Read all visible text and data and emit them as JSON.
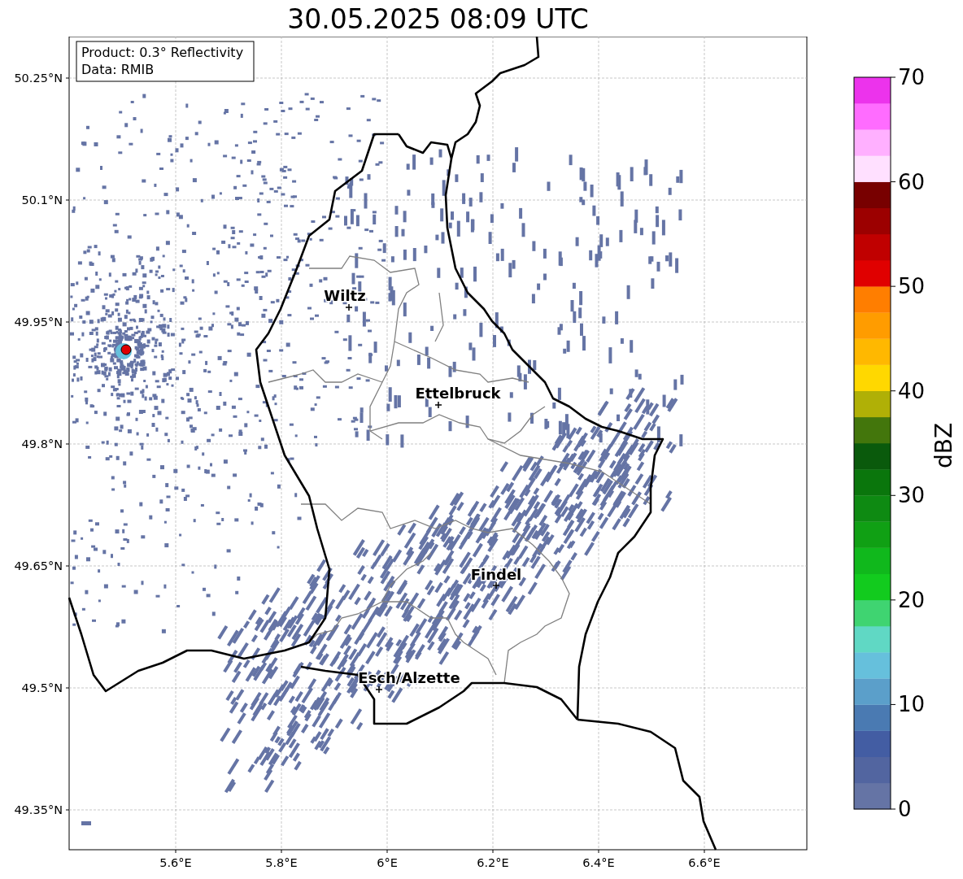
{
  "title": "30.05.2025 08:09 UTC",
  "info_box": [
    "Product: 0.3° Reflectivity",
    "Data: RMIB"
  ],
  "map": {
    "lat_labels": [
      "50.25°N",
      "50.1°N",
      "49.95°N",
      "49.8°N",
      "49.65°N",
      "49.5°N",
      "49.35°N"
    ],
    "lon_labels": [
      "5.6°E",
      "5.8°E",
      "6°E",
      "6.2°E",
      "6.4°E",
      "6.6°E"
    ],
    "places": [
      {
        "name": "Wiltz"
      },
      {
        "name": "Ettelbruck"
      },
      {
        "name": "Findel"
      },
      {
        "name": "Esch/Alzette"
      }
    ]
  },
  "colorbar": {
    "label": "dBZ",
    "ticks": [
      "70",
      "60",
      "50",
      "40",
      "30",
      "20",
      "10",
      "0"
    ],
    "bins": [
      {
        "color": "#6574a5"
      },
      {
        "color": "#5265a0"
      },
      {
        "color": "#435da3"
      },
      {
        "color": "#4a7ab2"
      },
      {
        "color": "#5b9fca"
      },
      {
        "color": "#66c0dc"
      },
      {
        "color": "#60d8c4"
      },
      {
        "color": "#3fd471"
      },
      {
        "color": "#12cb1e"
      },
      {
        "color": "#10b81c"
      },
      {
        "color": "#10a014"
      },
      {
        "color": "#0e8a12"
      },
      {
        "color": "#0a760c"
      },
      {
        "color": "#0a5a0c"
      },
      {
        "color": "#43760c"
      },
      {
        "color": "#b0b006"
      },
      {
        "color": "#ffd800"
      },
      {
        "color": "#ffb800"
      },
      {
        "color": "#ff9c00"
      },
      {
        "color": "#ff7e00"
      },
      {
        "color": "#e00000"
      },
      {
        "color": "#c00000"
      },
      {
        "color": "#9c0000"
      },
      {
        "color": "#780000"
      },
      {
        "color": "#ffe0ff"
      },
      {
        "color": "#ffb0ff"
      },
      {
        "color": "#ff6cff"
      },
      {
        "color": "#ec33ec"
      }
    ]
  }
}
